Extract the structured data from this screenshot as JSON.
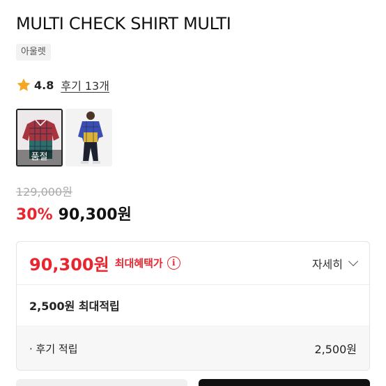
{
  "product": {
    "title": "MULTI CHECK SHIRT MULTI",
    "tag": "아울렛",
    "rating": "4.8",
    "review_link": "후기 13개",
    "soldout_label": "품절",
    "original_price": "129,000원",
    "discount": "30%",
    "sale_price": "90,300원"
  },
  "benefit": {
    "best_price": "90,300원",
    "best_label": "최대혜택가",
    "info_glyph": "i",
    "detail_toggle": "자세히",
    "points_text": "2,500원 최대적립",
    "review_points_label": "· 후기 적립",
    "review_points_amount": "2,500원"
  },
  "colors": {
    "accent_red": "#e8262f",
    "star": "#f5a623"
  },
  "icons": [
    "star-icon",
    "info-icon",
    "chevron-down-icon"
  ]
}
